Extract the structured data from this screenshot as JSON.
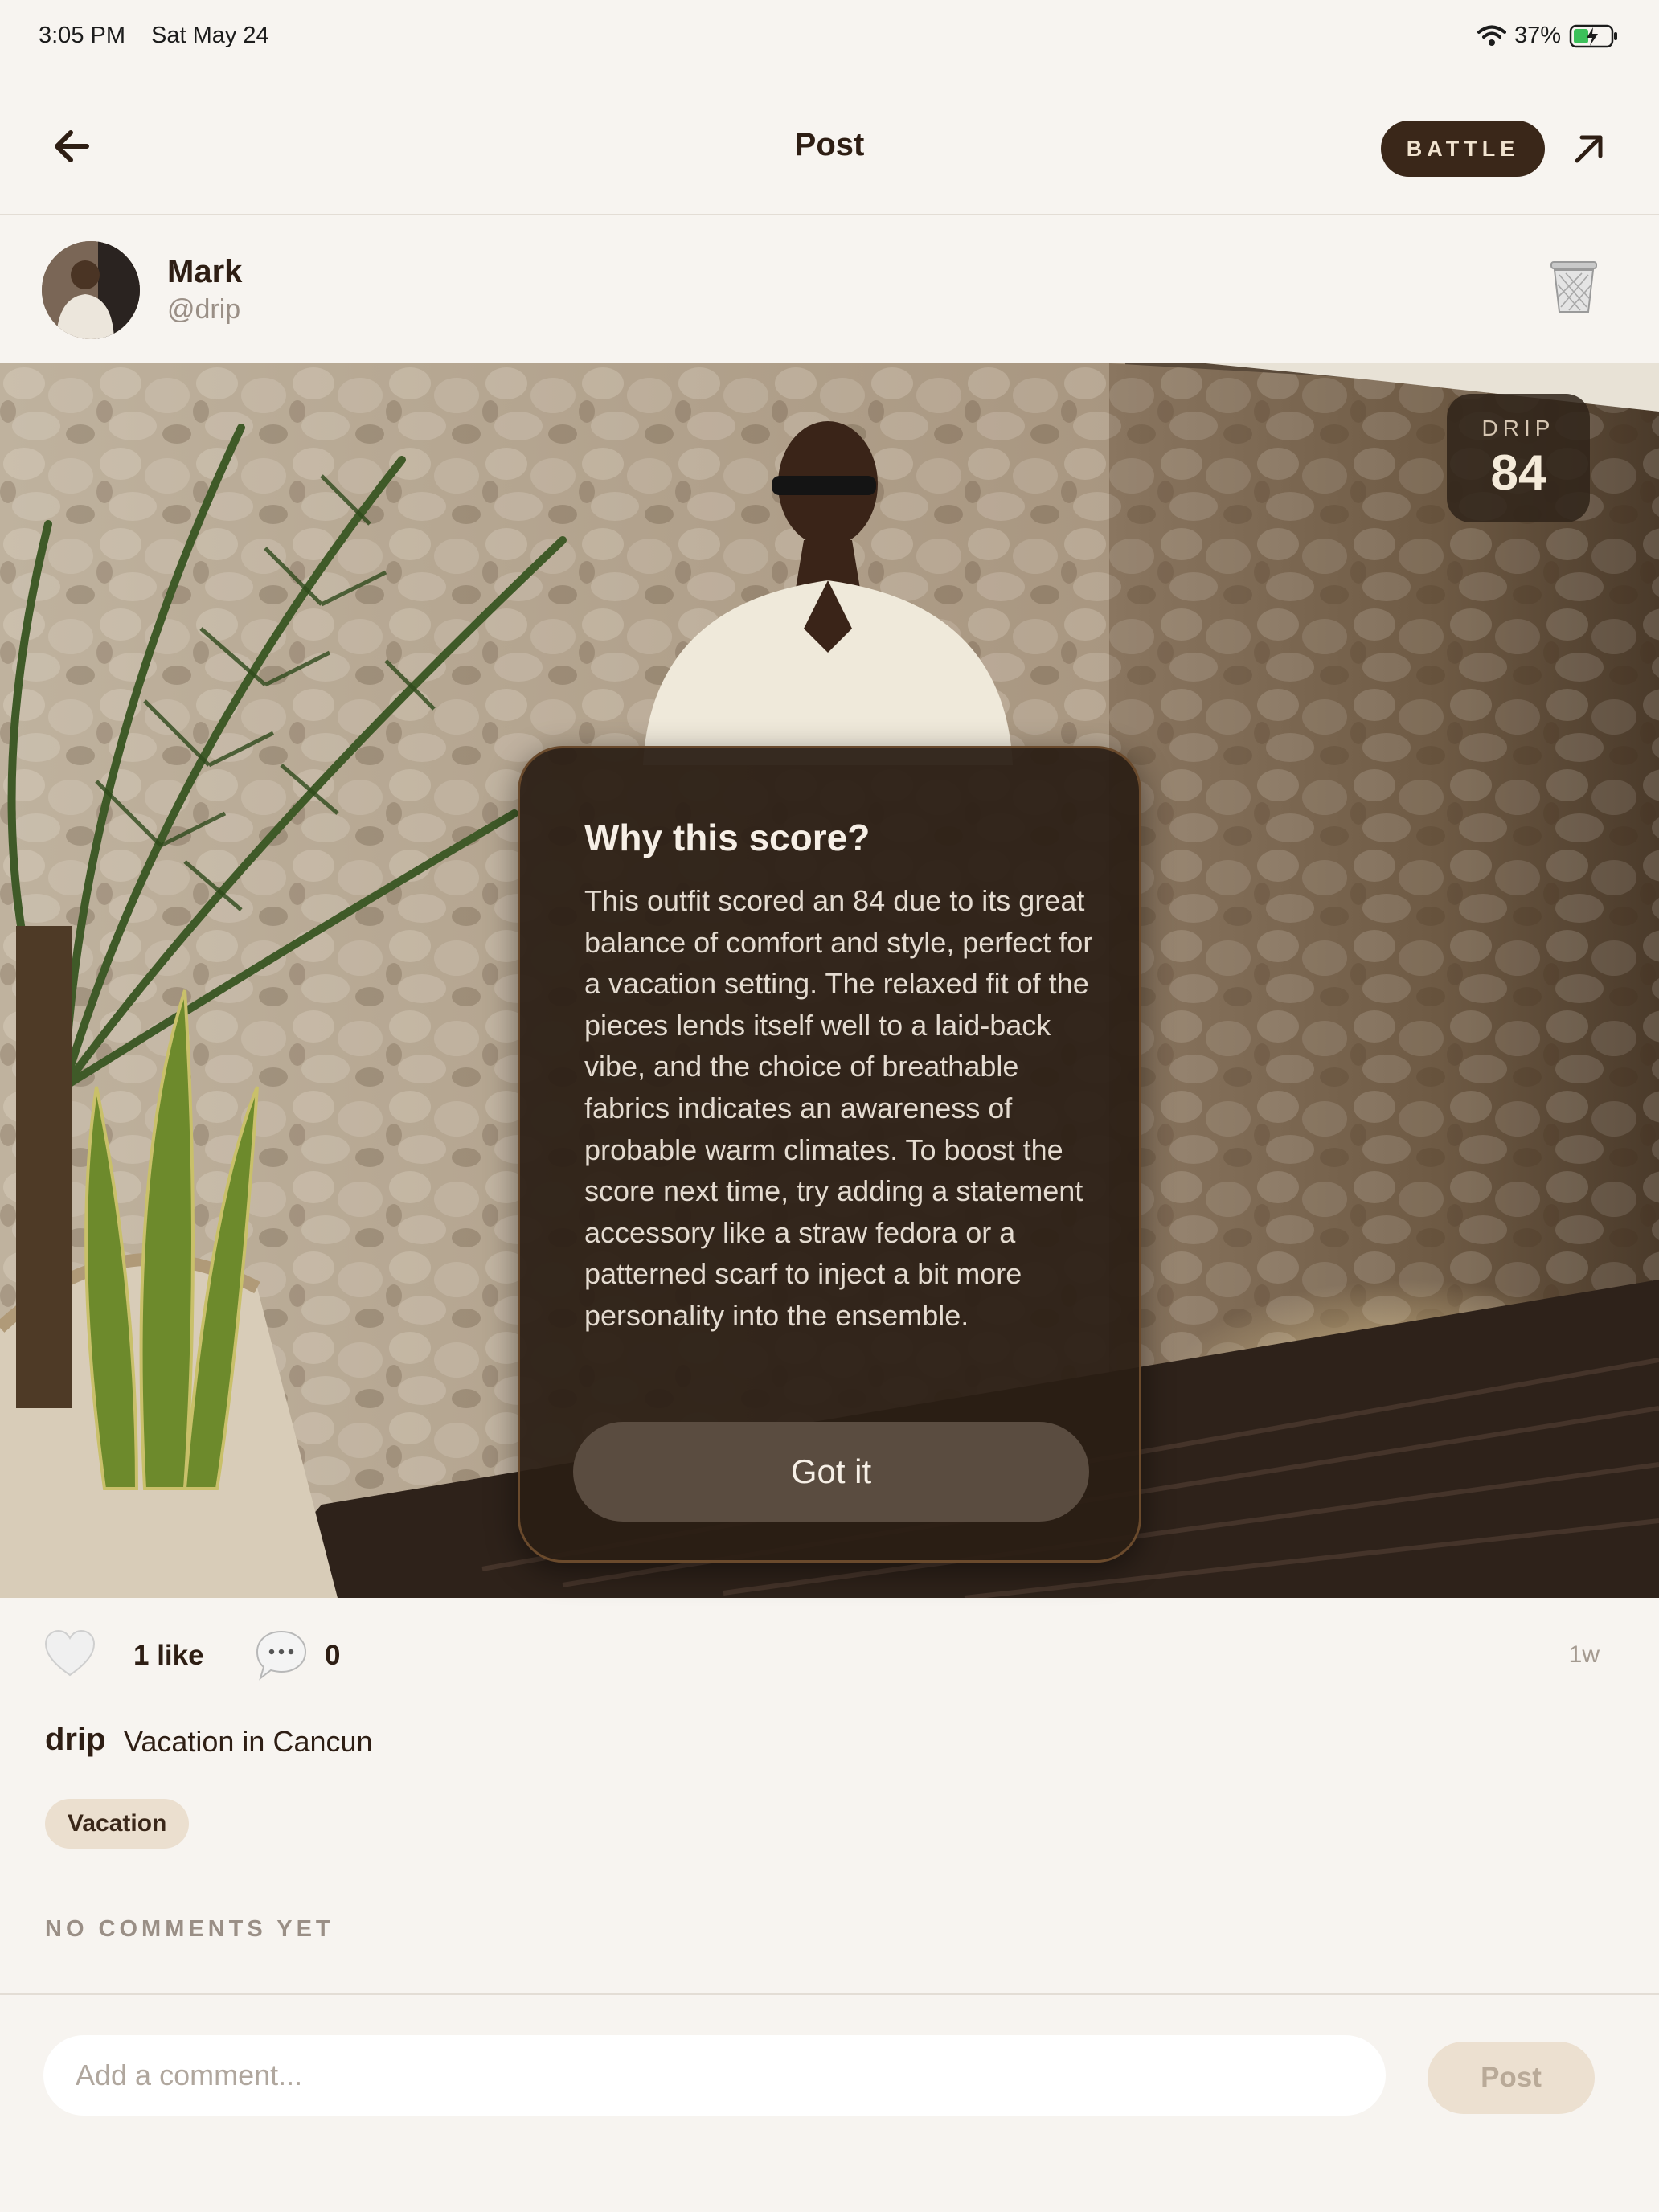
{
  "status_bar": {
    "time": "3:05 PM",
    "date": "Sat May 24",
    "battery": "37%",
    "icons": [
      "wifi-icon",
      "battery-charging-icon"
    ]
  },
  "nav": {
    "title": "Post",
    "battle_label": "BATTLE",
    "icons": [
      "back-arrow-icon",
      "share-arrow-icon"
    ]
  },
  "author": {
    "name": "Mark",
    "handle": "@drip"
  },
  "post": {
    "drip_label": "DRIP",
    "drip_score": "84",
    "likes": "1 like",
    "comments": "0",
    "time_ago": "1w",
    "caption_user": "drip",
    "caption": "Vacation in Cancun",
    "tag": "Vacation"
  },
  "modal": {
    "title": "Why this score?",
    "body": "This outfit scored an 84 due to its great balance of comfort and style, perfect for a vacation setting. The relaxed fit of the pieces lends itself well to a laid-back vibe, and the choice of breathable fabrics indicates an awareness of probable warm climates. To boost the score next time, try adding a statement accessory like a straw fedora or a patterned scarf to inject a bit more personality into the ensemble.",
    "button_label": "Got it"
  },
  "comments_section": {
    "empty_label": "NO COMMENTS YET",
    "input_placeholder": "Add a comment...",
    "post_label": "Post"
  },
  "colors": {
    "background": "#f7f4f0",
    "accent_dark": "#3a2719",
    "modal_bg": "#2a1e14",
    "tag_bg": "#ebdfcf"
  }
}
